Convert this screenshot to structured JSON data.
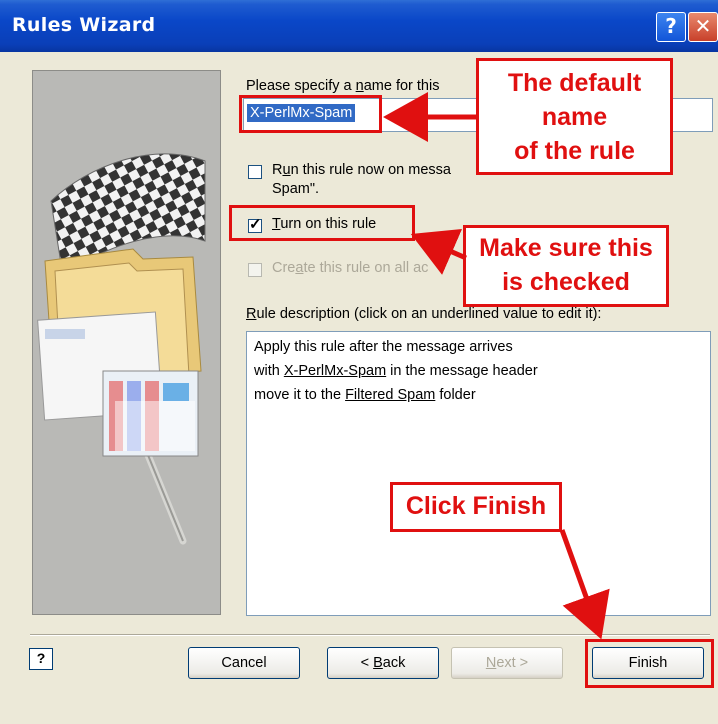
{
  "window": {
    "title": "Rules Wizard",
    "help_glyph": "?",
    "close_glyph": "✕"
  },
  "form": {
    "name_label": "Please specify a name for this",
    "name_label_accel": "n",
    "name_value": "X-PerlMx-Spam",
    "run_now": {
      "text_before": "R",
      "accel": "u",
      "text_after": "n this rule now on messa",
      "line2": "Spam\".",
      "checked": false,
      "enabled": true
    },
    "turn_on": {
      "accel": "T",
      "text_after": "urn on this rule",
      "checked": true,
      "enabled": true
    },
    "create_all": {
      "text_before": "Cre",
      "accel": "a",
      "text_after": "te this rule on all ac",
      "checked": false,
      "enabled": false
    },
    "desc_label_accel": "R",
    "desc_label_rest": "ule description (click on an underlined value to edit it):",
    "description": [
      {
        "pre": "Apply this rule after the message arrives",
        "link": "",
        "post": ""
      },
      {
        "pre": "with ",
        "link": "X-PerlMx-Spam",
        "post": " in the message header"
      },
      {
        "pre": "move it to the ",
        "link": "Filtered Spam",
        "post": " folder"
      }
    ]
  },
  "buttons": {
    "help_glyph": "?",
    "cancel": "Cancel",
    "back_prefix": "< ",
    "back_accel": "B",
    "back_rest": "ack",
    "next_accel": "N",
    "next_rest": "ext >",
    "finish": "Finish"
  },
  "annotations": {
    "default_name": [
      "The default",
      "name",
      "of the rule"
    ],
    "make_sure": [
      "Make sure this",
      "is checked"
    ],
    "click_finish": "Click Finish"
  },
  "colors": {
    "annotation_red": "#e01010",
    "titlebar_blue": "#0a47c8",
    "selection_blue": "#316ac5"
  }
}
